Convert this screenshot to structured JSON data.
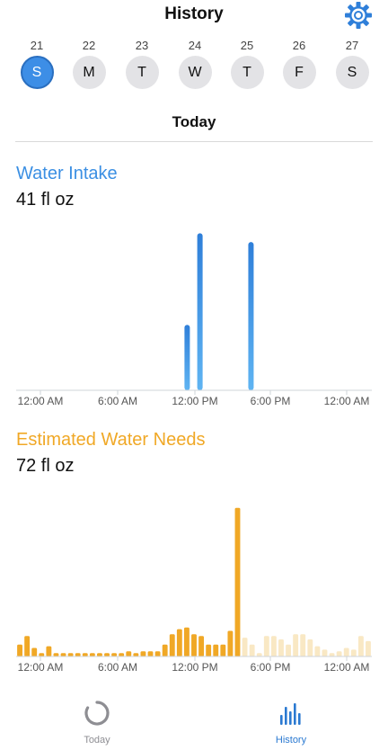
{
  "header": {
    "title": "History",
    "settings_icon": "gear-icon"
  },
  "colors": {
    "accent_blue": "#3d8ee6",
    "intake_blue": "#3b8fe3",
    "needs_orange": "#f0a826",
    "needs_orange_light": "#f9e8c4",
    "inactive_gray": "#8e8e93"
  },
  "week": {
    "days": [
      {
        "date": "21",
        "letter": "S",
        "selected": true
      },
      {
        "date": "22",
        "letter": "M",
        "selected": false
      },
      {
        "date": "23",
        "letter": "T",
        "selected": false
      },
      {
        "date": "24",
        "letter": "W",
        "selected": false
      },
      {
        "date": "25",
        "letter": "T",
        "selected": false
      },
      {
        "date": "26",
        "letter": "F",
        "selected": false
      },
      {
        "date": "27",
        "letter": "S",
        "selected": false
      }
    ]
  },
  "section": {
    "title": "Today"
  },
  "intake": {
    "label": "Water Intake",
    "value": "41 fl oz"
  },
  "needs": {
    "label": "Estimated Water Needs",
    "value": "72 fl oz"
  },
  "chart_data": [
    {
      "type": "bar",
      "title": "Water Intake",
      "x_tick_labels": [
        "12:00 AM",
        "6:00 AM",
        "12:00 PM",
        "6:00 PM",
        "12:00 AM"
      ],
      "x_unit": "hour of day",
      "bars": [
        {
          "hour": 11.5,
          "value": 7.5
        },
        {
          "hour": 12.5,
          "value": 18
        },
        {
          "hour": 16.5,
          "value": 17
        }
      ],
      "ylim": [
        0,
        20
      ],
      "grid": false,
      "colors": {
        "bar": "#3b8fe3"
      }
    },
    {
      "type": "bar",
      "title": "Estimated Water Needs",
      "x_tick_labels": [
        "12:00 AM",
        "6:00 AM",
        "12:00 PM",
        "6:00 PM",
        "12:00 AM"
      ],
      "x_unit": "half-hour slot",
      "values": [
        0.7,
        1.2,
        0.5,
        0.2,
        0.6,
        0.2,
        0.2,
        0.2,
        0.2,
        0.2,
        0.2,
        0.2,
        0.2,
        0.2,
        0.2,
        0.3,
        0.2,
        0.3,
        0.3,
        0.3,
        0.7,
        1.3,
        1.6,
        1.7,
        1.3,
        1.2,
        0.7,
        0.7,
        0.7,
        1.5,
        8.7,
        1.1,
        0.7,
        0.2,
        1.2,
        1.2,
        1.0,
        0.7,
        1.3,
        1.3,
        1.0,
        0.6,
        0.4,
        0.2,
        0.3,
        0.5,
        0.4,
        1.2,
        0.9
      ],
      "current_slot_index": 30,
      "ylim": [
        0,
        10
      ],
      "grid": false,
      "colors": {
        "past": "#f0a826",
        "future": "#f9e8c4"
      }
    }
  ],
  "tabbar": {
    "tabs": [
      {
        "label": "Today",
        "icon": "progress-ring-icon",
        "active": false
      },
      {
        "label": "History",
        "icon": "bar-chart-icon",
        "active": true
      }
    ]
  }
}
